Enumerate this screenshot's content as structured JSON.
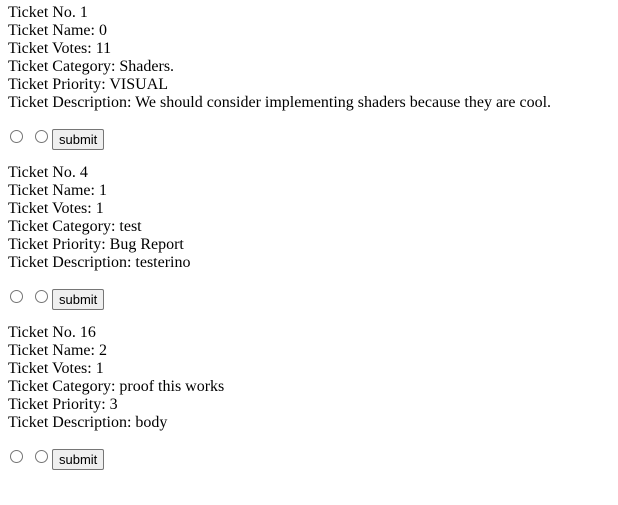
{
  "tickets": [
    {
      "no": "Ticket No. 1",
      "name": "Ticket Name: 0",
      "votes": "Ticket Votes: 11",
      "category": "Ticket Category: Shaders.",
      "priority": "Ticket Priority: VISUAL",
      "description": "Ticket Description: We should consider implementing shaders because they are cool.",
      "submit_label": "submit"
    },
    {
      "no": "Ticket No. 4",
      "name": "Ticket Name: 1",
      "votes": "Ticket Votes: 1",
      "category": "Ticket Category: test",
      "priority": "Ticket Priority: Bug Report",
      "description": "Ticket Description: testerino",
      "submit_label": "submit"
    },
    {
      "no": "Ticket No. 16",
      "name": "Ticket Name: 2",
      "votes": "Ticket Votes: 1",
      "category": "Ticket Category: proof this works",
      "priority": "Ticket Priority: 3",
      "description": "Ticket Description: body",
      "submit_label": "submit"
    }
  ]
}
